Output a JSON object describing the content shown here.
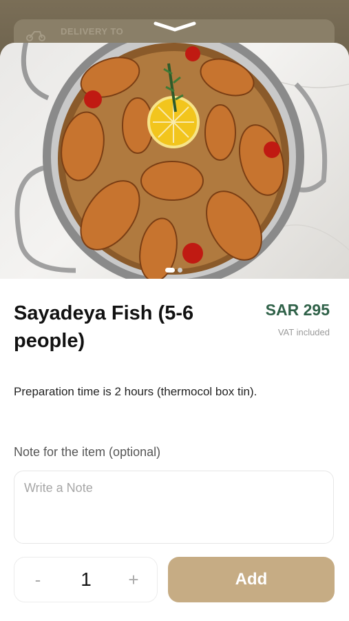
{
  "header": {
    "delivery_label": "DELIVERY TO",
    "delivery_icon": "scooter-icon",
    "handle_icon": "chevron-down-icon"
  },
  "product": {
    "image_icon": "food-photo",
    "carousel_count": 2,
    "carousel_active": 1,
    "title": "Sayadeya Fish (5-6 people)",
    "price": "SAR 295",
    "vat": "VAT included",
    "description": "Preparation time is 2 hours (thermocol box tin)."
  },
  "note": {
    "label": "Note for the item (optional)",
    "placeholder": "Write a Note",
    "value": ""
  },
  "quantity": {
    "minus": "-",
    "value": "1",
    "plus": "+"
  },
  "actions": {
    "add_label": "Add"
  },
  "colors": {
    "accent": "#c6ac84",
    "price": "#2f6148",
    "header": "#6b604b"
  }
}
